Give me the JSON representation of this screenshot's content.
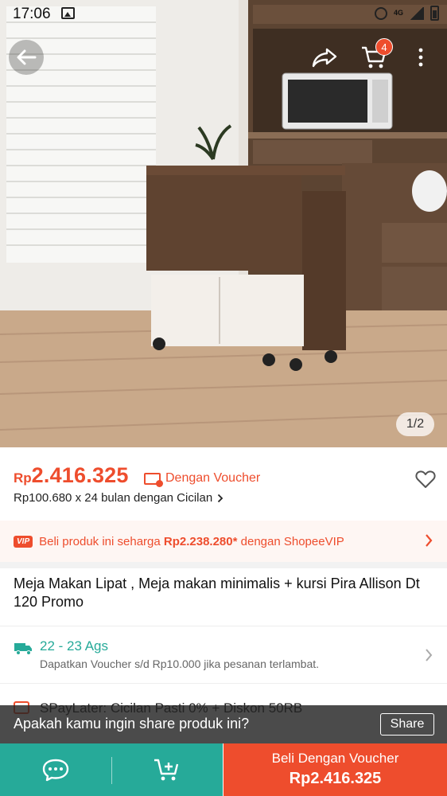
{
  "status_bar": {
    "time": "17:06",
    "net_label": "4G"
  },
  "hero": {
    "image_counter": "1/2",
    "cart_badge_count": "4"
  },
  "price": {
    "currency": "Rp",
    "amount": "2.416.325",
    "voucher_label": "Dengan Voucher",
    "installment_text": "Rp100.680 x 24 bulan dengan Cicilan"
  },
  "vip_banner": {
    "badge": "VIP",
    "text_before": "Beli produk ini seharga ",
    "vip_price": "Rp2.238.280*",
    "text_after": " dengan ShopeeVIP"
  },
  "product_title": "Meja Makan Lipat , Meja makan minimalis + kursi Pira Allison Dt 120 Promo",
  "shipping": {
    "dates": "22 - 23 Ags",
    "note": "Dapatkan Voucher s/d Rp10.000 jika pesanan terlambat."
  },
  "spaylater": {
    "text": "SPayLater: Cicilan Pasti 0% + Diskon 50RB"
  },
  "share_prompt": {
    "message": "Apakah kamu ingin share produk ini?",
    "button_label": "Share"
  },
  "bottom_bar": {
    "buy_label": "Beli Dengan Voucher",
    "buy_price": "Rp2.416.325"
  },
  "colors": {
    "brand": "#ee4d2d",
    "teal": "#26aa99"
  },
  "icons": [
    "back-arrow-icon",
    "share-icon",
    "cart-icon",
    "more-vert-icon",
    "voucher-icon",
    "heart-icon",
    "truck-icon",
    "chat-icon",
    "add-to-cart-icon"
  ]
}
